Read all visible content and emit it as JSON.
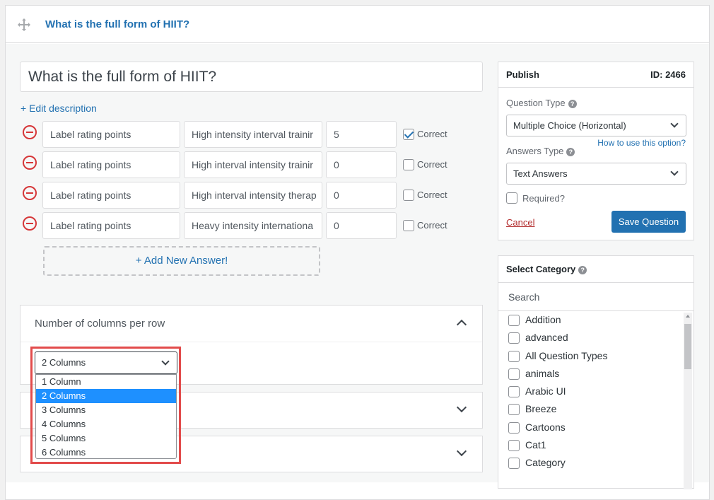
{
  "header": {
    "title": "What is the full form of HIIT?"
  },
  "question": {
    "title": "What is the full form of HIIT?",
    "edit_description": "+ Edit description"
  },
  "answers": [
    {
      "label": "Label rating points",
      "text": "High intensity interval trainir",
      "points": "5",
      "correct": true
    },
    {
      "label": "Label rating points",
      "text": "High interval intensity trainir",
      "points": "0",
      "correct": false
    },
    {
      "label": "Label rating points",
      "text": "High interval intensity therap",
      "points": "0",
      "correct": false
    },
    {
      "label": "Label rating points",
      "text": "Heavy intensity internationa",
      "points": "0",
      "correct": false
    }
  ],
  "correct_label": "Correct",
  "add_new_answer": "+ Add New Answer!",
  "columns_panel": {
    "title": "Number of columns per row",
    "selected": "2 Columns",
    "options": [
      "1 Column",
      "2 Columns",
      "3 Columns",
      "4 Columns",
      "5 Columns",
      "6 Columns"
    ],
    "highlighted_option": "2 Columns"
  },
  "publish": {
    "title": "Publish",
    "id_label": "ID: 2466",
    "question_type_label": "Question Type",
    "question_type_value": "Multiple Choice (Horizontal)",
    "answers_type_label": "Answers Type",
    "how_to_link": "How to use this option?",
    "answers_type_value": "Text Answers",
    "required_label": "Required?",
    "cancel": "Cancel",
    "save": "Save Question"
  },
  "category": {
    "title": "Select Category",
    "search_placeholder": "Search",
    "items": [
      "Addition",
      "advanced",
      "All Question Types",
      "animals",
      "Arabic UI",
      "Breeze",
      "Cartoons",
      "Cat1",
      "Category"
    ]
  },
  "help_glyph": "?",
  "colors": {
    "accent": "#2271b1",
    "danger": "#d63638",
    "highlight": "#1e90ff",
    "annotation": "#e24b4b"
  }
}
